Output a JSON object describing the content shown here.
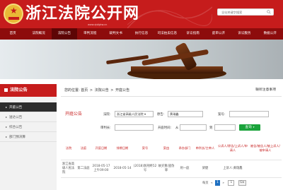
{
  "header": {
    "title": "浙江法院公开网",
    "domain": "www.zjsfgkw.cn",
    "search_placeholder": "全站关键字搜索"
  },
  "nav": {
    "items": [
      "首页",
      "法院概况",
      "法院公告",
      "审判流程",
      "裁判文书",
      "执行信息",
      "司法拍卖信息",
      "诉讼指南",
      "庭审公开",
      "诉讼服务",
      "数据公开"
    ],
    "active_index": 2
  },
  "sidebar": {
    "title": "法院公告",
    "items": [
      "开庭公告",
      "送达公告",
      "综合公告",
      "部门预决算"
    ],
    "active_index": 0
  },
  "breadcrumb": {
    "prefix": "您的位置:",
    "items": [
      "首页",
      "法院公告",
      "开庭公告"
    ],
    "separator": ">",
    "help_link": "联听注意事项"
  },
  "filter": {
    "section_title": "开庭公告",
    "court_label": "法院:",
    "court_value": "浙江省高级人民法院",
    "plaintiff_label": "原告:",
    "plaintiff_value": "黄瑞鑫",
    "case_no_label": "案号:",
    "case_no_value": "",
    "judge_label": "审判长:",
    "judge_value": "",
    "time_label": "开庭时间:",
    "from_label": "从",
    "to_label": "到",
    "from_value": "",
    "to_value": "",
    "query_label": "查询"
  },
  "table": {
    "headers": [
      "法院",
      "法庭",
      "开庭日期",
      "排期日期",
      "案号",
      "案由",
      "承办部门",
      "审判长/主审人",
      "公诉人/原告/上诉人/申请人",
      "被告/被告人/被上诉人/被申请人"
    ],
    "rows": [
      [
        "浙江省高级人民法院",
        "第二法庭",
        "2018-05-17 上午09:00",
        "2018-05-14",
        "(2018)浙刑终52号",
        "故买重/盗伪罪",
        "刑一庭",
        "梁健",
        "上诉人:黄瑞鑫",
        ""
      ]
    ]
  },
  "pager": {
    "page_label": "每页",
    "prev": "«",
    "current": "1",
    "next": "»",
    "goto_value": "1",
    "go_label": "Go"
  },
  "colors": {
    "brand_red": "#c61c1c",
    "nav_dark": "#8d0c0c",
    "query_green": "#1aa33b",
    "pager_blue": "#1f70c1"
  }
}
